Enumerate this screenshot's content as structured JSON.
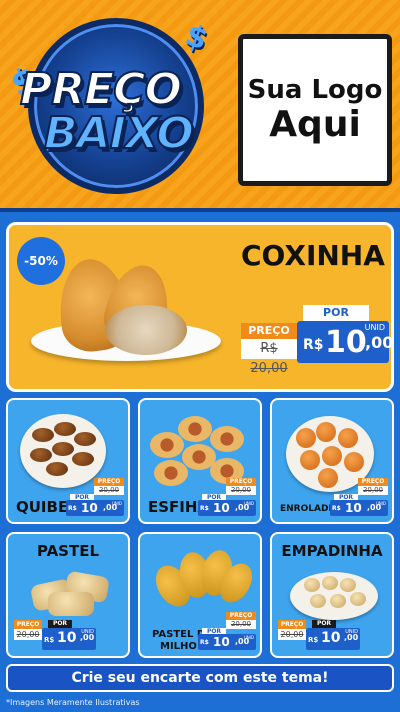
{
  "header": {
    "badge_line1": "PREÇO",
    "badge_line2": "BAIXO",
    "dollar_sign": "$",
    "logo_line1": "Sua Logo",
    "logo_line2": "Aqui"
  },
  "featured": {
    "discount": "-50%",
    "title": "COXINHA",
    "por_label": "POR",
    "preco_label": "PREÇO",
    "old_price": "R$ 20,00",
    "currency": "R$",
    "price_whole": "10",
    "price_cents": ",00",
    "unit": "UNID"
  },
  "products": [
    {
      "name": "QUIBE",
      "preco_label": "PREÇO",
      "old_price": "20,00",
      "por_label": "POR",
      "currency": "R$",
      "price_whole": "10",
      "price_cents": ",00",
      "unit": "UNID"
    },
    {
      "name": "ESFIHA",
      "preco_label": "PREÇO",
      "old_price": "20,00",
      "por_label": "POR",
      "currency": "R$",
      "price_whole": "10",
      "price_cents": ",00",
      "unit": "UNID"
    },
    {
      "name": "ENROLADINHO",
      "preco_label": "PREÇO",
      "old_price": "20,00",
      "por_label": "POR",
      "currency": "R$",
      "price_whole": "10",
      "price_cents": ",00",
      "unit": "UNID"
    },
    {
      "name": "PASTEL",
      "preco_label": "PREÇO",
      "old_price": "20,00",
      "por_label": "POR",
      "currency": "R$",
      "price_whole": "10",
      "price_cents": ",00",
      "unit": "UNID"
    },
    {
      "name_line1": "PASTEL DE",
      "name_line2": "MILHO",
      "preco_label": "PREÇO",
      "old_price": "20,00",
      "por_label": "POR",
      "currency": "R$",
      "price_whole": "10",
      "price_cents": ",00",
      "unit": "UNID"
    },
    {
      "name": "EMPADINHA",
      "preco_label": "PREÇO",
      "old_price": "20,00",
      "por_label": "POR",
      "currency": "R$",
      "price_whole": "10",
      "price_cents": ",00",
      "unit": "UNID"
    }
  ],
  "cta": {
    "label": "Crie seu encarte com este tema!"
  },
  "footnote": "*Imagens Meramente Ilustrativas",
  "colors": {
    "background": "#1d6fd6",
    "header_orange": "#f7a31c",
    "featured_yellow": "#f7b52b",
    "card_blue": "#3ea4ee",
    "price_blue": "#1f5fc9",
    "preco_orange": "#f08a1a"
  }
}
